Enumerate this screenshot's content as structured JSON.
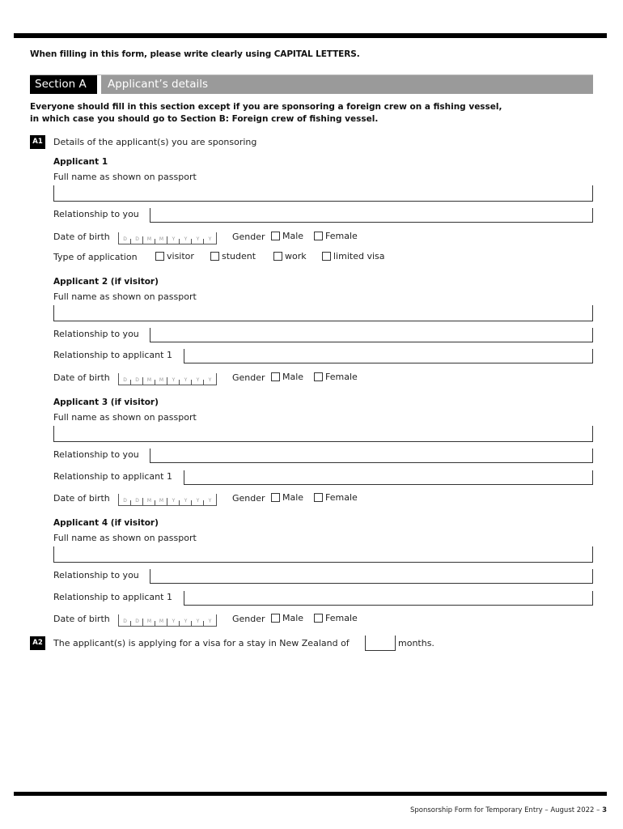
{
  "intro": "When filling in this form, please write clearly using CAPITAL LETTERS.",
  "section": {
    "label": "Section A",
    "title": "Applicant’s details",
    "note_line1": "Everyone should fill in this section except if you are sponsoring a foreign crew on a fishing vessel,",
    "note_line2": "in which case you should go to Section B: Foreign crew of fishing vessel."
  },
  "questions": {
    "a1": {
      "badge": "A1",
      "text": "Details of the applicant(s) you are sponsoring"
    },
    "a2": {
      "badge": "A2",
      "text_before": "The applicant(s) is applying for a visa for a stay in New Zealand of",
      "text_after": "months.",
      "months_value": ""
    }
  },
  "labels": {
    "full_name": "Full name as shown on passport",
    "rel_you": "Relationship to you",
    "rel_app1": "Relationship to applicant 1",
    "dob": "Date of birth",
    "gender": "Gender",
    "male": "Male",
    "female": "Female",
    "type_app": "Type of application",
    "dob_placeholder": [
      "D",
      "D",
      "M",
      "M",
      "Y",
      "Y",
      "Y",
      "Y"
    ]
  },
  "application_types": [
    "visitor",
    "student",
    "work",
    "limited visa"
  ],
  "applicants": [
    {
      "heading": "Applicant 1",
      "full_name": "",
      "rel_you": "",
      "dob": "",
      "gender": null
    },
    {
      "heading": "Applicant 2  (if visitor)",
      "full_name": "",
      "rel_you": "",
      "rel_app1": "",
      "dob": "",
      "gender": null
    },
    {
      "heading": "Applicant 3  (if visitor)",
      "full_name": "",
      "rel_you": "",
      "rel_app1": "",
      "dob": "",
      "gender": null
    },
    {
      "heading": "Applicant 4  (if visitor)",
      "full_name": "",
      "rel_you": "",
      "rel_app1": "",
      "dob": "",
      "gender": null
    }
  ],
  "footer": {
    "text": "Sponsorship Form for Temporary Entry – August 2022 – ",
    "page": "3"
  }
}
